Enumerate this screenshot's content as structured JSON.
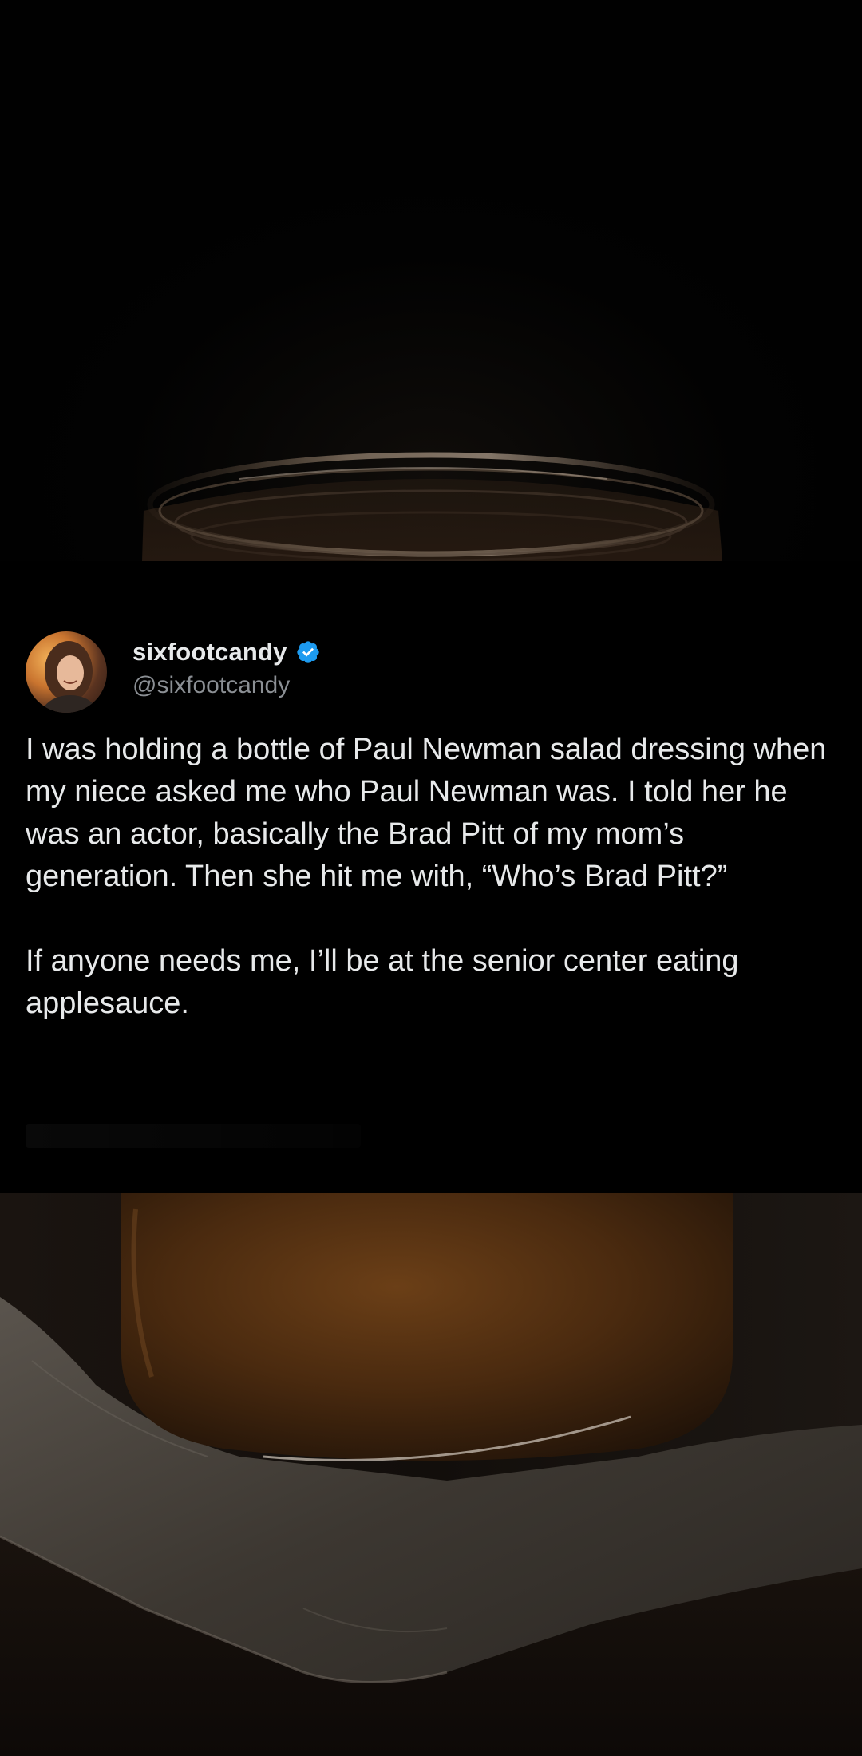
{
  "tweet": {
    "display_name": "sixfootcandy",
    "handle": "@sixfootcandy",
    "verified": true,
    "paragraphs": [
      "I was holding a bottle of Paul Newman salad dressing when my niece asked me who Paul Newman was. I told her he was an actor, basically the Brad Pitt of my mom’s generation. Then she hit me with, “Who’s Brad Pitt?”",
      "If anyone needs me, I’ll be at the senior center eating applesauce."
    ]
  },
  "colors": {
    "background": "#000000",
    "primary_text": "#e7e9ea",
    "secondary_text": "#8b8f94",
    "verified_badge": "#1d9bf0"
  }
}
